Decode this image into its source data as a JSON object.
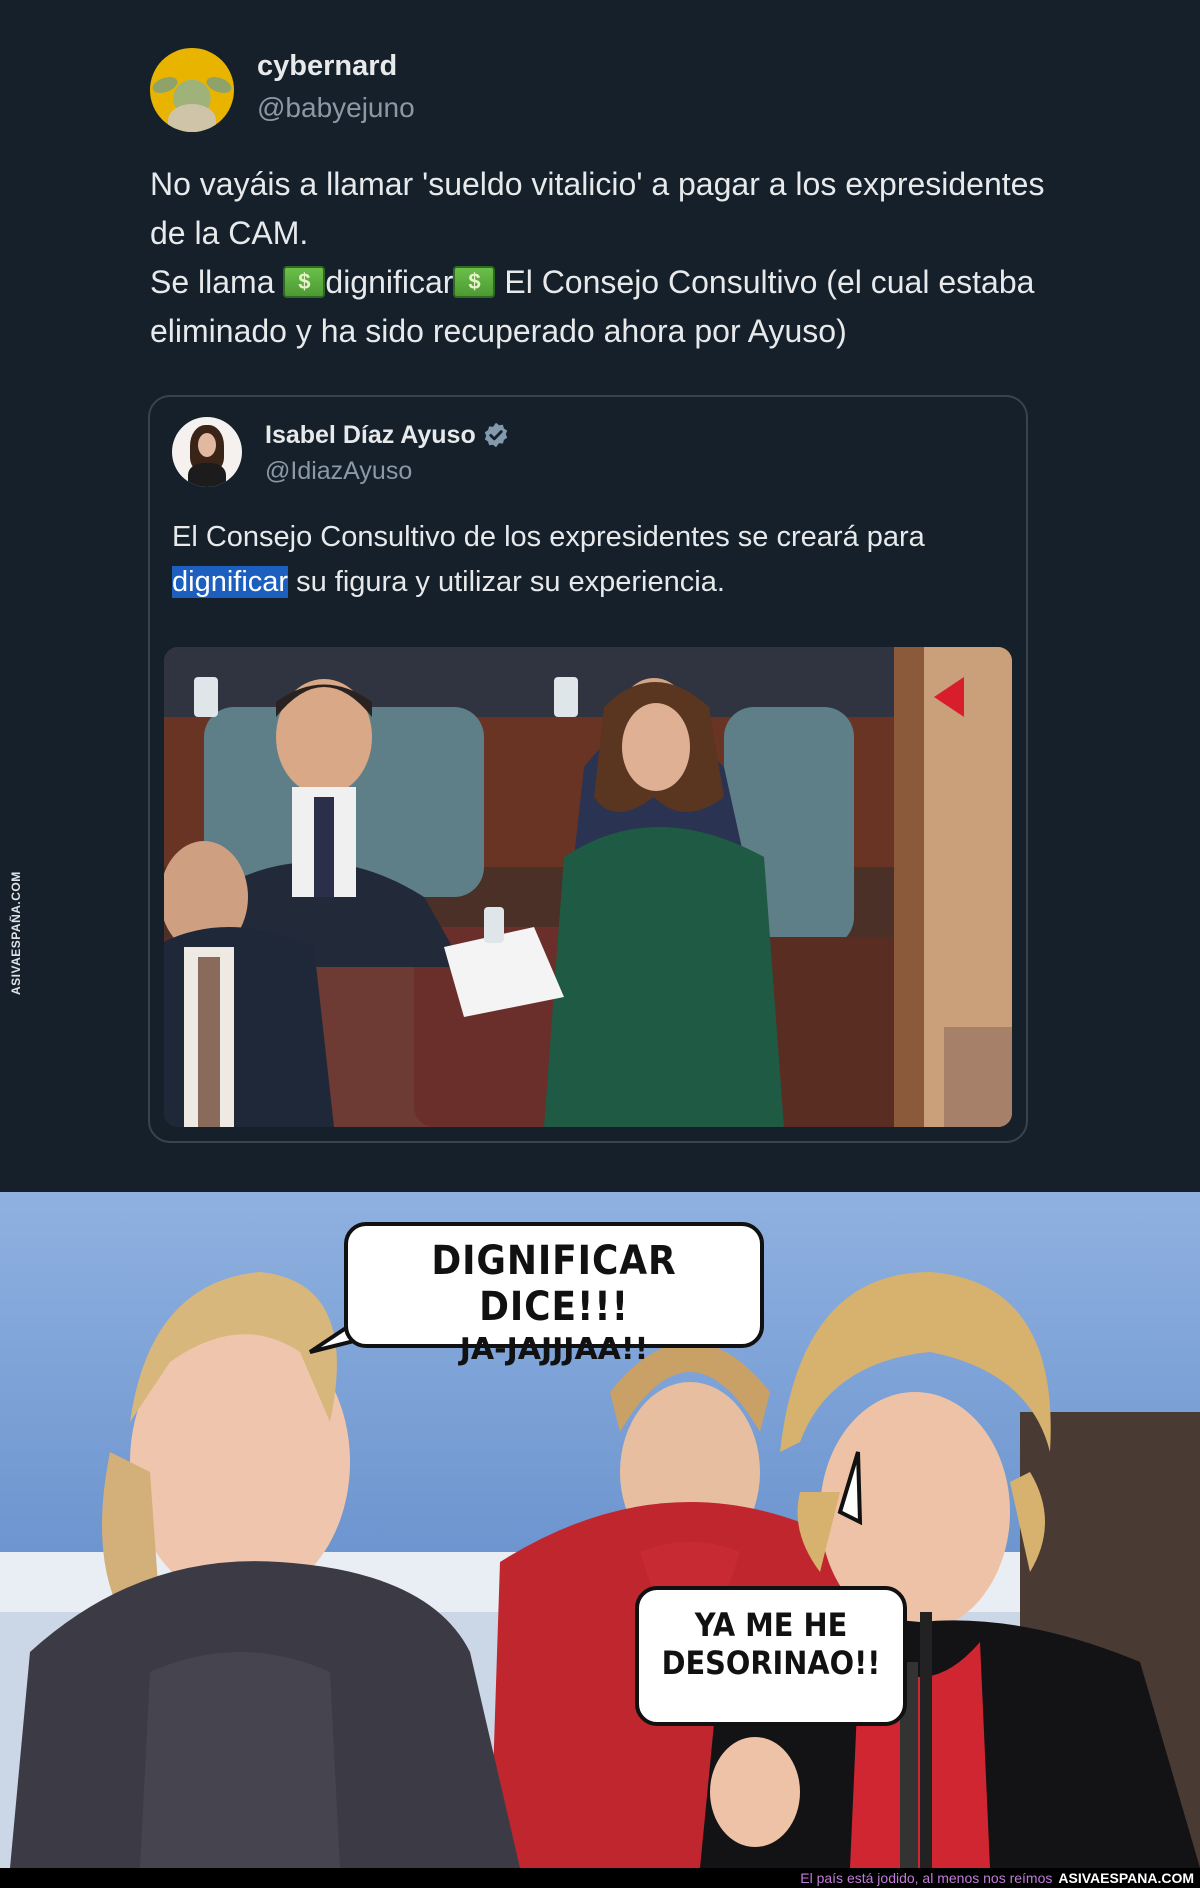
{
  "tweet": {
    "author_name": "cybernard",
    "author_handle": "@babyejuno",
    "text_line1": "No vayáis a llamar 'sueldo vitalicio' a pagar a los expresidentes de la CAM.",
    "text_line2_a": "Se llama ",
    "text_line2_b": "dignificar",
    "text_line2_c": " El Consejo Consultivo (el cual estaba eliminado y ha sido recuperado ahora por Ayuso)",
    "emoji_icon": "money-bill-icon"
  },
  "quoted_tweet": {
    "author_name": "Isabel Díaz Ayuso",
    "author_handle": "@IdiazAyuso",
    "verified_icon": "verified-badge-icon",
    "text_a": "El Consejo Consultivo de los expresidentes se creará para ",
    "text_highlight": "dignificar",
    "text_b": " su figura y utilizar su experiencia."
  },
  "side_watermark": "ASIVAESPAÑA.COM",
  "meme": {
    "bubble_top_line1": "DIGNIFICAR DICE!!!",
    "bubble_top_line2": "JA-JAJJJAA!!",
    "bubble_bottom_line1": "YA ME HE",
    "bubble_bottom_line2": "DESORINAO!!"
  },
  "footer": {
    "tagline": "El país está jodido, al menos nos reímos",
    "site": "ASIVAESPANA.COM"
  },
  "colors": {
    "background": "#15202b",
    "text": "#e7e9ea",
    "muted": "#8b98a5",
    "highlight": "#1d5fbf",
    "border": "#38444d"
  }
}
